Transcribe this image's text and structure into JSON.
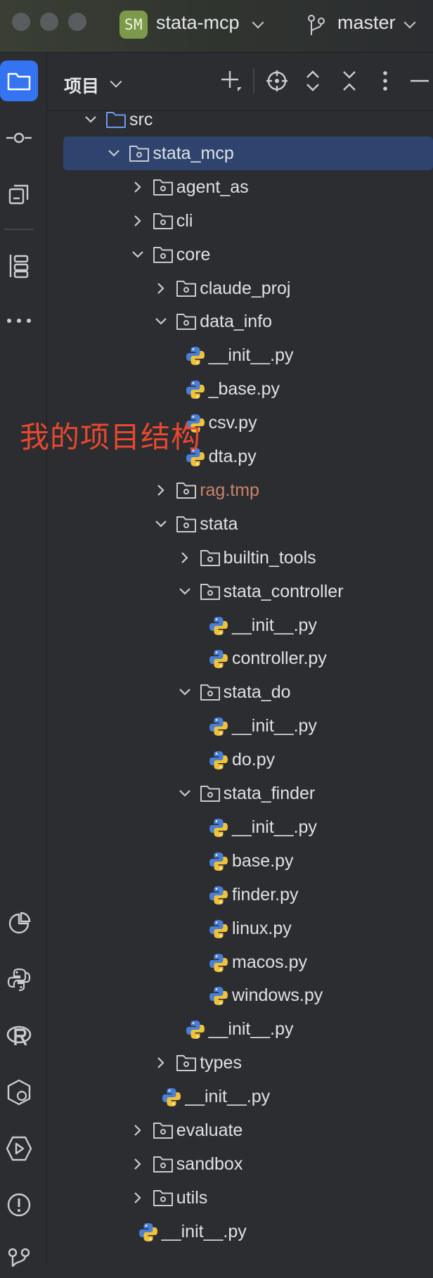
{
  "titlebar": {
    "project_badge": "SM",
    "project_name": "stata-mcp",
    "branch": "master"
  },
  "panel": {
    "title": "项目"
  },
  "annotation": "我的项目结构",
  "colors": {
    "accent": "#3574f0",
    "selection": "#2e436e",
    "folder_src": "#6e9bf5",
    "ignored_text": "#c9836a",
    "annotation_text": "#e8482f",
    "python_blue": "#4a7fd6",
    "python_yellow": "#f0c23b"
  },
  "tree": [
    {
      "label": "src",
      "kind": "src-folder",
      "depth": 0,
      "state": "expanded"
    },
    {
      "label": "stata_mcp",
      "kind": "package",
      "depth": 1,
      "state": "expanded",
      "selected": true
    },
    {
      "label": "agent_as",
      "kind": "package",
      "depth": 2,
      "state": "collapsed"
    },
    {
      "label": "cli",
      "kind": "package",
      "depth": 2,
      "state": "collapsed"
    },
    {
      "label": "core",
      "kind": "package",
      "depth": 2,
      "state": "expanded"
    },
    {
      "label": "claude_proj",
      "kind": "package",
      "depth": 3,
      "state": "collapsed"
    },
    {
      "label": "data_info",
      "kind": "package",
      "depth": 3,
      "state": "expanded"
    },
    {
      "label": "__init__.py",
      "kind": "python",
      "depth": 4
    },
    {
      "label": "_base.py",
      "kind": "python",
      "depth": 4
    },
    {
      "label": "csv.py",
      "kind": "python",
      "depth": 4
    },
    {
      "label": "dta.py",
      "kind": "python",
      "depth": 4
    },
    {
      "label": "rag.tmp",
      "kind": "package",
      "depth": 3,
      "state": "collapsed",
      "ignored": true
    },
    {
      "label": "stata",
      "kind": "package",
      "depth": 3,
      "state": "expanded"
    },
    {
      "label": "builtin_tools",
      "kind": "package",
      "depth": 4,
      "state": "collapsed"
    },
    {
      "label": "stata_controller",
      "kind": "package",
      "depth": 4,
      "state": "expanded"
    },
    {
      "label": "__init__.py",
      "kind": "python",
      "depth": 5
    },
    {
      "label": "controller.py",
      "kind": "python",
      "depth": 5
    },
    {
      "label": "stata_do",
      "kind": "package",
      "depth": 4,
      "state": "expanded"
    },
    {
      "label": "__init__.py",
      "kind": "python",
      "depth": 5
    },
    {
      "label": "do.py",
      "kind": "python",
      "depth": 5
    },
    {
      "label": "stata_finder",
      "kind": "package",
      "depth": 4,
      "state": "expanded"
    },
    {
      "label": "__init__.py",
      "kind": "python",
      "depth": 5
    },
    {
      "label": "base.py",
      "kind": "python",
      "depth": 5
    },
    {
      "label": "finder.py",
      "kind": "python",
      "depth": 5
    },
    {
      "label": "linux.py",
      "kind": "python",
      "depth": 5
    },
    {
      "label": "macos.py",
      "kind": "python",
      "depth": 5
    },
    {
      "label": "windows.py",
      "kind": "python",
      "depth": 5
    },
    {
      "label": "__init__.py",
      "kind": "python",
      "depth": 4
    },
    {
      "label": "types",
      "kind": "package",
      "depth": 3,
      "state": "collapsed"
    },
    {
      "label": "__init__.py",
      "kind": "python",
      "depth": 3
    },
    {
      "label": "evaluate",
      "kind": "package",
      "depth": 2,
      "state": "collapsed"
    },
    {
      "label": "sandbox",
      "kind": "package",
      "depth": 2,
      "state": "collapsed"
    },
    {
      "label": "utils",
      "kind": "package",
      "depth": 2,
      "state": "collapsed"
    },
    {
      "label": "__init__.py",
      "kind": "python",
      "depth": 2
    }
  ],
  "left_strip_icons": [
    "project-folder-icon",
    "commit-icon",
    "pull-requests-icon",
    "structure-icon",
    "more-icon",
    "profiler-icon",
    "python-packages-icon",
    "r-console-icon",
    "python-console-icon",
    "run-icon",
    "problems-icon",
    "git-icon"
  ],
  "header_icons": [
    "add-icon",
    "locate-icon",
    "expand-all-icon",
    "collapse-all-icon",
    "options-icon",
    "hide-icon"
  ]
}
